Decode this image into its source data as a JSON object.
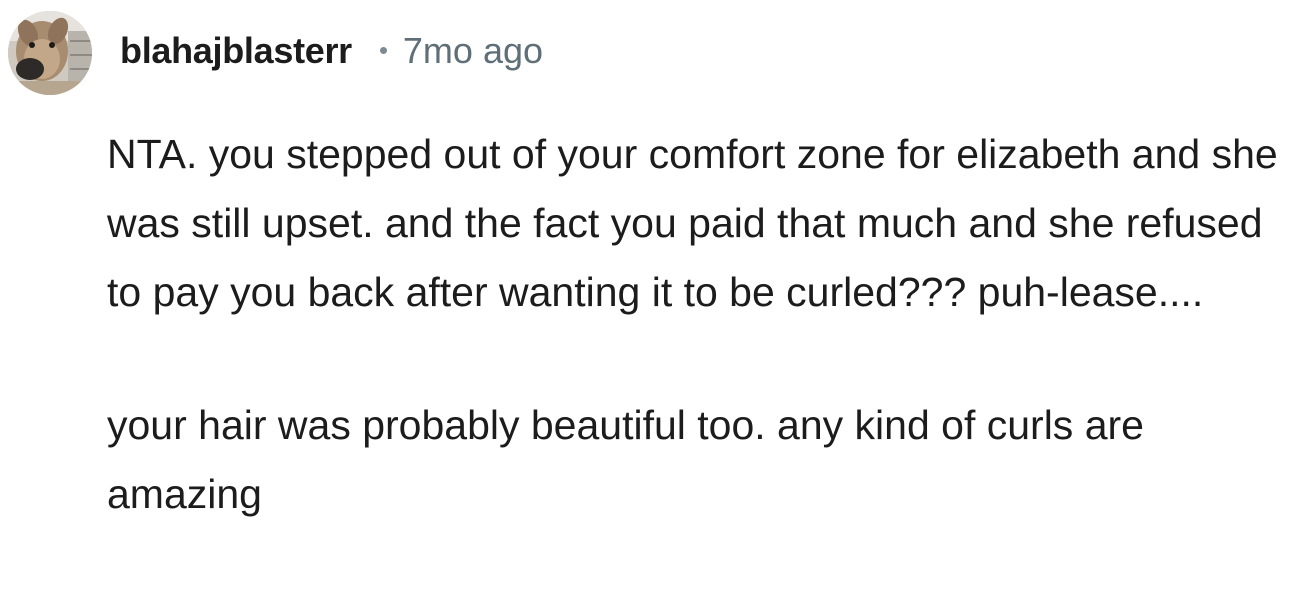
{
  "comment": {
    "author": "blahajblasterr",
    "separator": "•",
    "timestamp": "7mo ago",
    "avatar_icon": "deer-photo-avatar",
    "paragraphs": [
      "NTA. you stepped out of your comfort zone for elizabeth and she was still upset. and the fact you paid that much and she refused to pay you back after wanting it to be curled??? puh-lease....",
      "your hair was probably beautiful too. any kind of curls are amazing"
    ]
  }
}
